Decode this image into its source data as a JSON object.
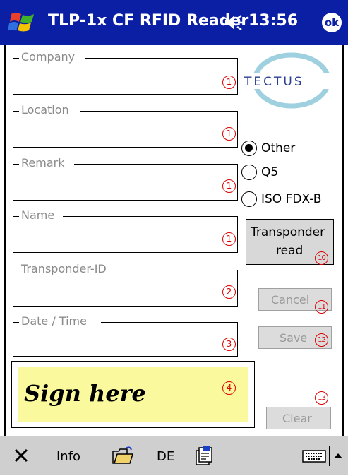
{
  "titlebar": {
    "title": "TLP-1x CF RFID Reader",
    "time": "13:56",
    "ok_label": "ok",
    "accent": "#0a1fa3"
  },
  "logo": {
    "text": "TECTUS"
  },
  "fields": [
    {
      "label": "Company",
      "value": "",
      "marker": "1"
    },
    {
      "label": "Location",
      "value": "",
      "marker": "1"
    },
    {
      "label": "Remark",
      "value": "",
      "marker": "1"
    },
    {
      "label": "Name",
      "value": "",
      "marker": "1"
    },
    {
      "label": "Transponder-ID",
      "value": "",
      "marker": "2"
    },
    {
      "label": "Date / Time",
      "value": "",
      "marker": "3"
    }
  ],
  "radio": {
    "options": [
      "Other",
      "Q5",
      "ISO FDX-B"
    ],
    "selected": "Other"
  },
  "buttons": {
    "transponder_read": "Transponder read",
    "transponder_read_line1": "Transponder",
    "transponder_read_line2": "read",
    "transponder_marker": "10",
    "cancel": "Cancel",
    "cancel_marker": "11",
    "save": "Save",
    "save_marker": "12",
    "clear": "Clear",
    "clear_marker": "13"
  },
  "signature": {
    "text": "Sign here",
    "marker": "4",
    "color": "#fbf99e"
  },
  "taskbar": {
    "info": "Info",
    "lang": "DE"
  },
  "icons": [
    "windows-flag-icon",
    "speaker-icon",
    "close-x-icon",
    "folder-open-icon",
    "settings-doc-icon",
    "keyboard-icon",
    "arrow-up-icon"
  ]
}
